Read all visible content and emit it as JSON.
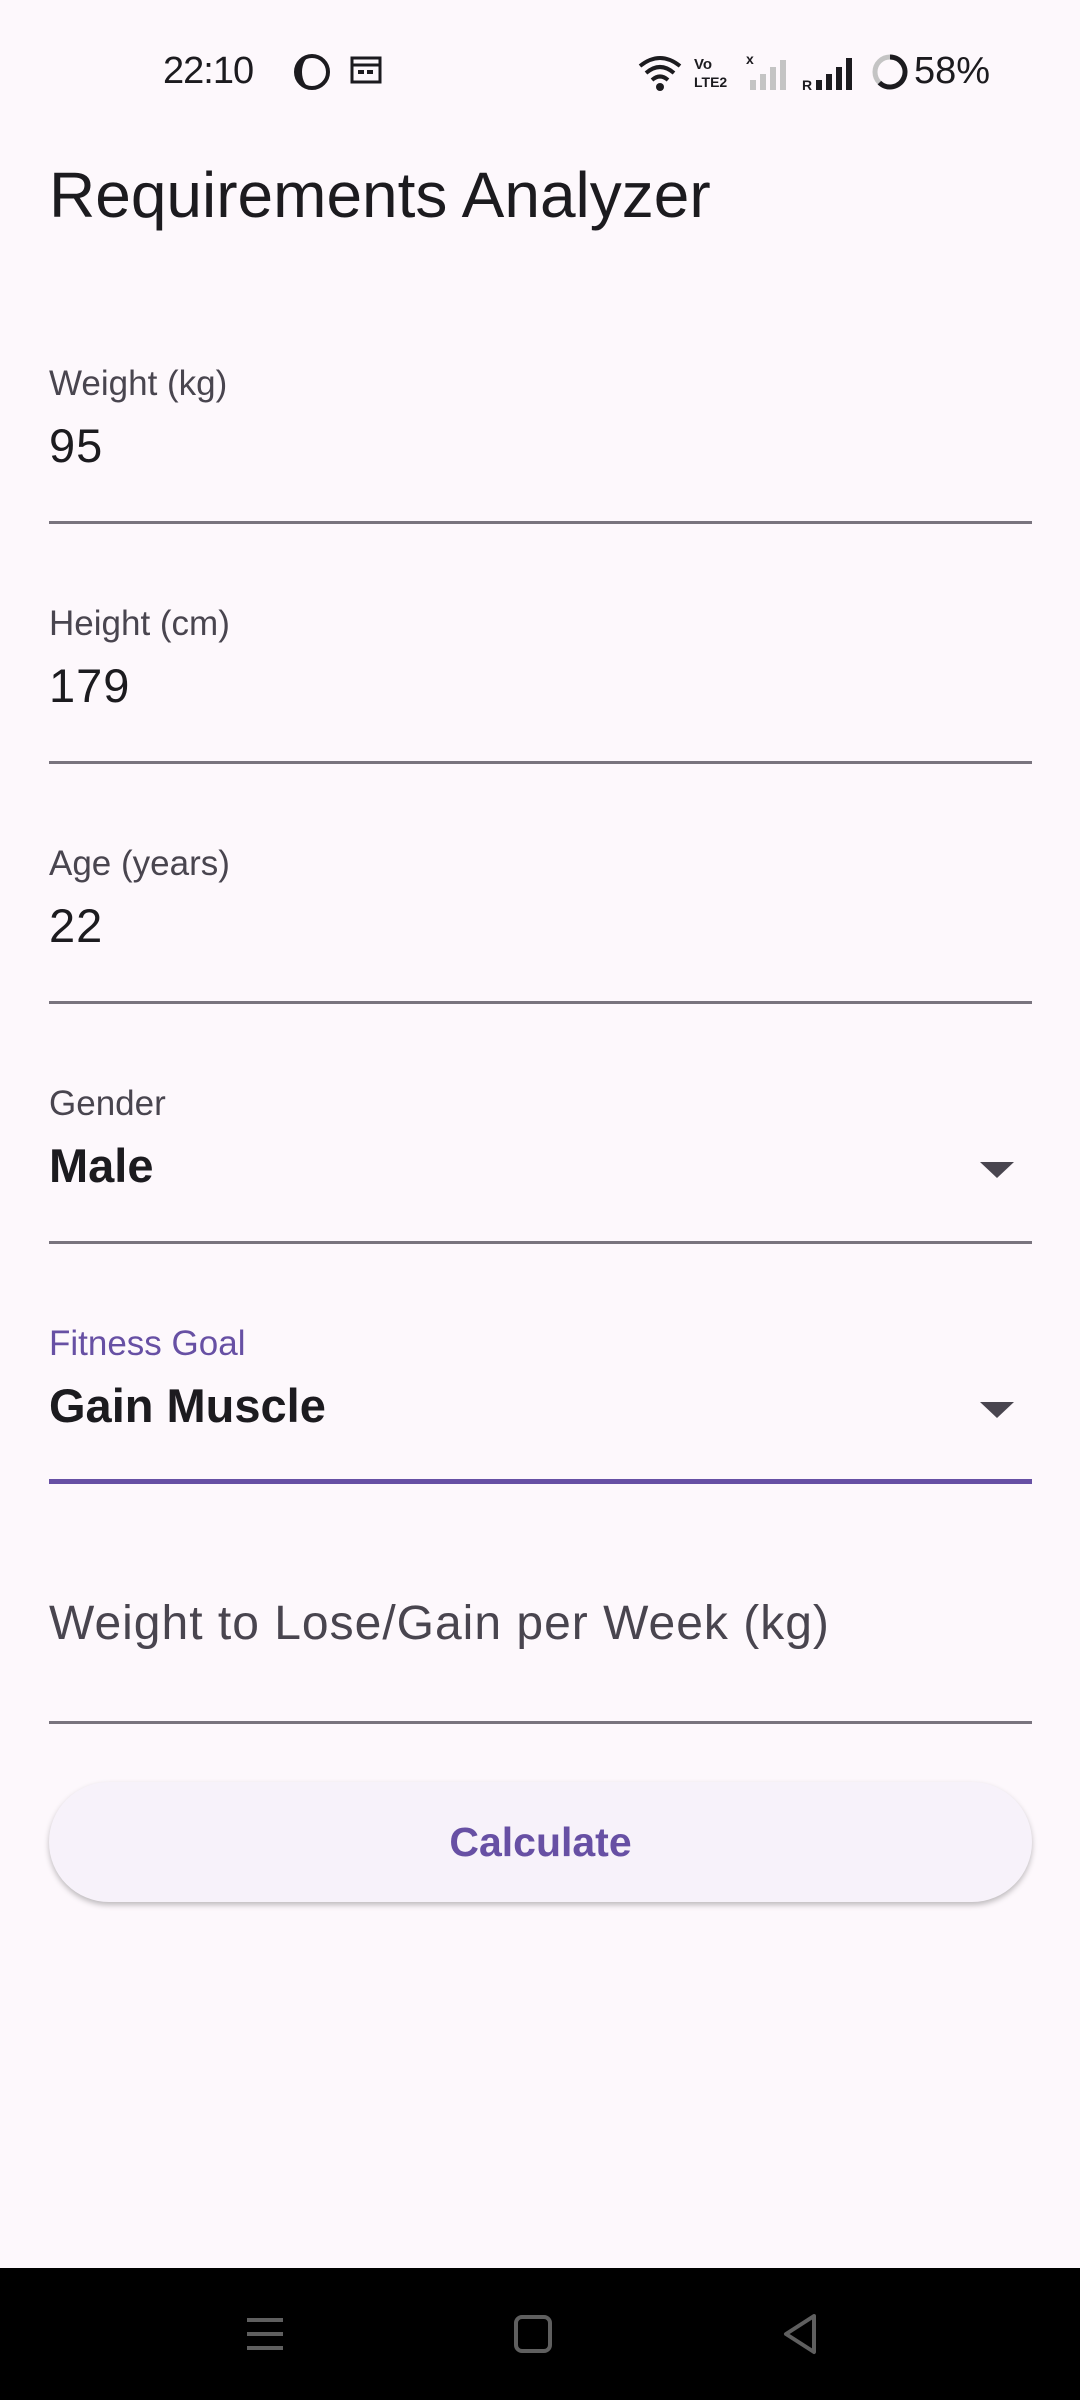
{
  "status_bar": {
    "time": "22:10",
    "battery": "58%",
    "icons": [
      "moon-icon",
      "calendar-icon",
      "wifi-icon",
      "volte-icon",
      "signal-off-icon",
      "signal-icon",
      "battery-icon"
    ]
  },
  "page": {
    "title": "Requirements Analyzer"
  },
  "form": {
    "weight": {
      "label": "Weight (kg)",
      "value": "95"
    },
    "height": {
      "label": "Height (cm)",
      "value": "179"
    },
    "age": {
      "label": "Age (years)",
      "value": "22"
    },
    "gender": {
      "label": "Gender",
      "value": "Male"
    },
    "fitness_goal": {
      "label": "Fitness Goal",
      "value": "Gain Muscle"
    },
    "weekly_change": {
      "placeholder": "Weight to Lose/Gain per Week (kg)"
    }
  },
  "actions": {
    "calculate_label": "Calculate"
  },
  "colors": {
    "accent": "#6750a4",
    "background": "#fdf8fc",
    "underline": "#79747e"
  }
}
